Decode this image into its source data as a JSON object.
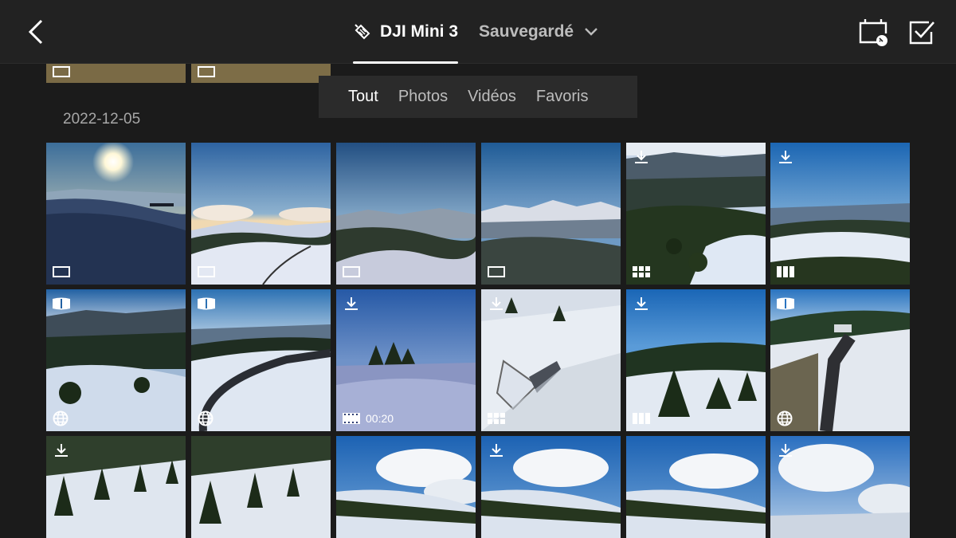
{
  "header": {
    "drone_name": "DJI Mini 3",
    "storage_filter": "Sauvegardé"
  },
  "filters": [
    {
      "label": "Tout",
      "active": true
    },
    {
      "label": "Photos",
      "active": false
    },
    {
      "label": "Vidéos",
      "active": false
    },
    {
      "label": "Favoris",
      "active": false
    }
  ],
  "section": {
    "date": "2022-12-05"
  },
  "media": [
    {
      "kind": "photo",
      "download": false,
      "pano": false
    },
    {
      "kind": "photo",
      "download": false,
      "pano": false
    },
    {
      "kind": "photo",
      "download": false,
      "pano": false
    },
    {
      "kind": "photo",
      "download": false,
      "pano": false
    },
    {
      "kind": "pano-grid",
      "download": true,
      "pano": false
    },
    {
      "kind": "pano-wide",
      "download": true,
      "pano": false
    },
    {
      "kind": "sphere",
      "download": false,
      "pano": true
    },
    {
      "kind": "sphere",
      "download": false,
      "pano": true
    },
    {
      "kind": "video",
      "download": true,
      "pano": false,
      "duration": "00:20"
    },
    {
      "kind": "pano-grid",
      "download": true,
      "pano": false
    },
    {
      "kind": "pano-wide",
      "download": true,
      "pano": false
    },
    {
      "kind": "sphere",
      "download": false,
      "pano": true
    },
    {
      "kind": "photo",
      "download": true,
      "pano": false
    },
    {
      "kind": "photo",
      "download": false,
      "pano": false
    },
    {
      "kind": "photo",
      "download": false,
      "pano": false
    },
    {
      "kind": "photo",
      "download": true,
      "pano": false
    },
    {
      "kind": "photo",
      "download": false,
      "pano": false
    },
    {
      "kind": "photo",
      "download": true,
      "pano": false
    }
  ]
}
